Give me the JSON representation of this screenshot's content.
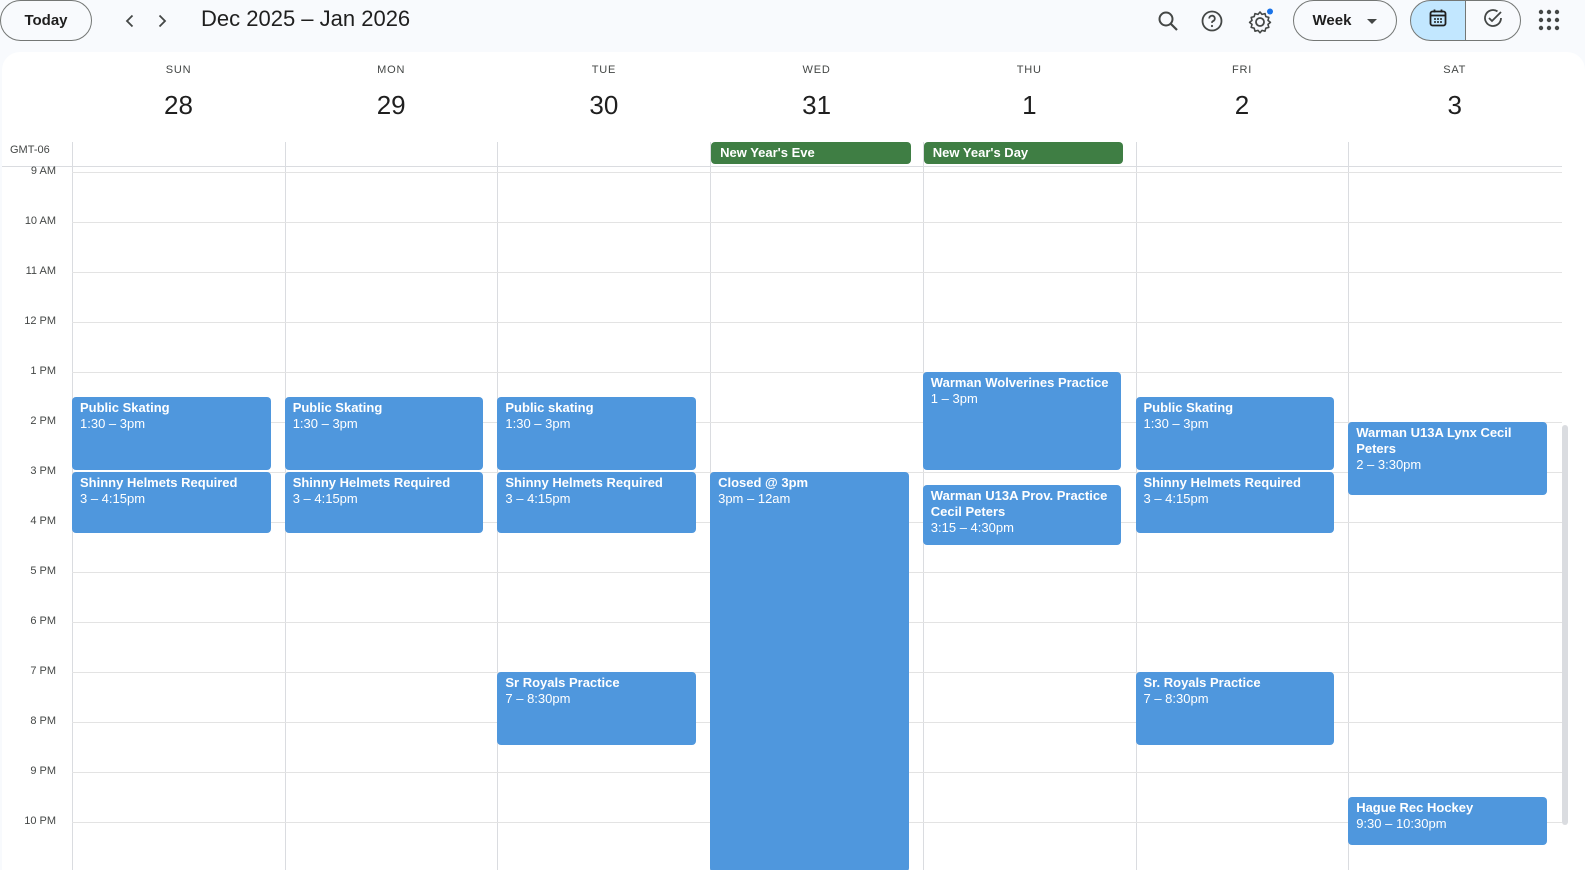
{
  "header": {
    "today_label": "Today",
    "date_range": "Dec 2025 – Jan 2026",
    "view_label": "Week"
  },
  "icons": {
    "prev": "chevron-left-icon",
    "next": "chevron-right-icon",
    "search": "search-icon",
    "help": "help-icon",
    "settings": "gear-icon",
    "calendar": "calendar-icon",
    "tasks": "check-circle-icon",
    "apps": "apps-grid-icon"
  },
  "colors": {
    "event_blue": "#4f97dd",
    "holiday_green": "#3f7e44",
    "selected_segment": "#c2e7ff",
    "notification_dot": "#1a73e8"
  },
  "timezone": "GMT-06",
  "days": [
    {
      "name": "SUN",
      "num": "28"
    },
    {
      "name": "MON",
      "num": "29"
    },
    {
      "name": "TUE",
      "num": "30"
    },
    {
      "name": "WED",
      "num": "31"
    },
    {
      "name": "THU",
      "num": "1"
    },
    {
      "name": "FRI",
      "num": "2"
    },
    {
      "name": "SAT",
      "num": "3"
    }
  ],
  "hours": [
    "9 AM",
    "10 AM",
    "11 AM",
    "12 PM",
    "1 PM",
    "2 PM",
    "3 PM",
    "4 PM",
    "5 PM",
    "6 PM",
    "7 PM",
    "8 PM",
    "9 PM",
    "10 PM"
  ],
  "all_day_events": [
    {
      "day": 3,
      "title": "New Year's Eve"
    },
    {
      "day": 4,
      "title": "New Year's Day"
    }
  ],
  "events": [
    {
      "day": 0,
      "title": "Public Skating",
      "time": "1:30 – 3pm"
    },
    {
      "day": 0,
      "title": "Shinny Helmets Required",
      "time": "3 – 4:15pm"
    },
    {
      "day": 1,
      "title": "Public Skating",
      "time": "1:30 – 3pm"
    },
    {
      "day": 1,
      "title": "Shinny Helmets Required",
      "time": "3 – 4:15pm"
    },
    {
      "day": 2,
      "title": "Public skating",
      "time": "1:30 – 3pm"
    },
    {
      "day": 2,
      "title": "Shinny Helmets Required",
      "time": "3 – 4:15pm"
    },
    {
      "day": 2,
      "title": "Sr Royals Practice",
      "time": "7 – 8:30pm"
    },
    {
      "day": 3,
      "title": "Closed @ 3pm",
      "time": "3pm – 12am"
    },
    {
      "day": 4,
      "title": "Warman Wolverines Practice",
      "time": "1 – 3pm"
    },
    {
      "day": 4,
      "title": "Warman U13A Prov. Practice Cecil Peters",
      "time": "3:15 – 4:30pm"
    },
    {
      "day": 5,
      "title": "Public Skating",
      "time": "1:30 – 3pm"
    },
    {
      "day": 5,
      "title": "Shinny Helmets Required",
      "time": "3 – 4:15pm"
    },
    {
      "day": 5,
      "title": "Sr. Royals Practice",
      "time": "7 – 8:30pm"
    },
    {
      "day": 6,
      "title": "Warman U13A Lynx Cecil Peters",
      "time": "2 – 3:30pm"
    },
    {
      "day": 6,
      "title": "Hague Rec Hockey",
      "time": "9:30 – 10:30pm"
    }
  ]
}
